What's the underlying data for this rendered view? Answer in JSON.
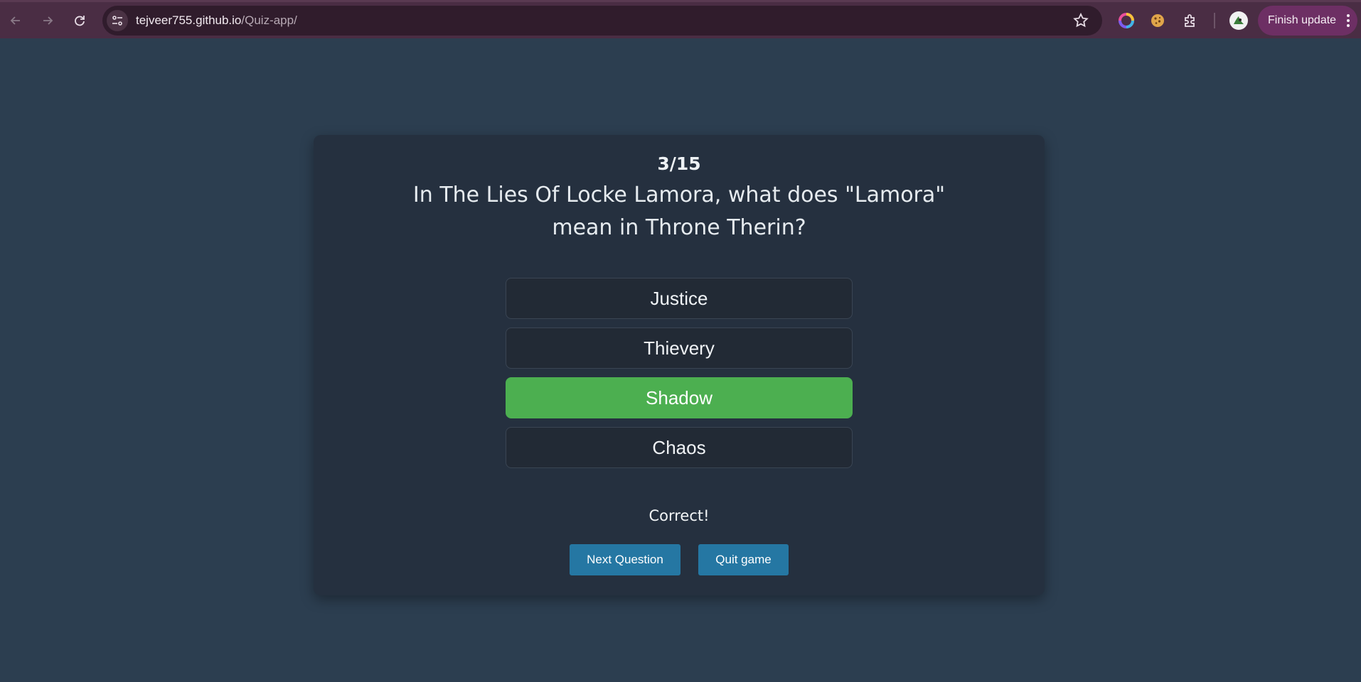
{
  "browser": {
    "url_host": "tejveer755.github.io",
    "url_path": "/Quiz-app/",
    "update_label": "Finish update"
  },
  "quiz": {
    "progress": "3/15",
    "question": "In The Lies Of Locke Lamora, what does \"Lamora\" mean in Throne Therin?",
    "options": [
      {
        "label": "Justice",
        "state": "default"
      },
      {
        "label": "Thievery",
        "state": "default"
      },
      {
        "label": "Shadow",
        "state": "correct"
      },
      {
        "label": "Chaos",
        "state": "default"
      }
    ],
    "feedback": "Correct!",
    "next_label": "Next Question",
    "quit_label": "Quit game"
  },
  "colors": {
    "page_bg": "#2c3e50",
    "card_bg": "#25303f",
    "correct_green": "#4caf50",
    "action_blue": "#2577a3",
    "browser_chrome": "#4a2d44"
  },
  "icons": [
    "back-arrow-icon",
    "forward-arrow-icon",
    "reload-icon",
    "site-info-icon",
    "star-icon",
    "color-wheel-extension-icon",
    "cookie-extension-icon",
    "puzzle-extensions-icon",
    "profile-avatar-icon",
    "more-vert-icon"
  ]
}
